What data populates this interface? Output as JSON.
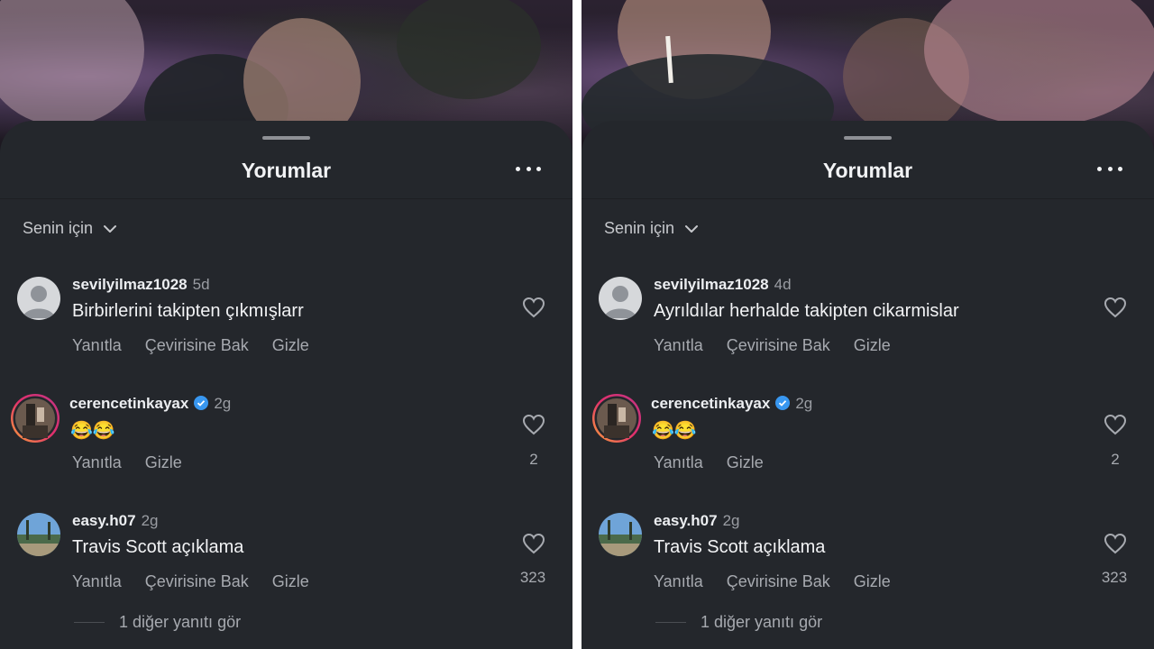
{
  "left": {
    "title": "Yorumlar",
    "filter_label": "Senin için",
    "comments": [
      {
        "username": "sevilyilmaz1028",
        "time": "5d",
        "text": "Birbirlerini takipten çıkmışlarr",
        "actions": [
          "Yanıtla",
          "Çevirisine Bak",
          "Gizle"
        ],
        "likes": ""
      },
      {
        "username": "cerencetinkayax",
        "time": "2g",
        "text": "😂😂",
        "actions": [
          "Yanıtla",
          "Gizle"
        ],
        "likes": "2"
      },
      {
        "username": "easy.h07",
        "time": "2g",
        "text": "Travis Scott açıklama",
        "actions": [
          "Yanıtla",
          "Çevirisine Bak",
          "Gizle"
        ],
        "likes": "323"
      }
    ],
    "more_replies": "1 diğer yanıtı gör"
  },
  "right": {
    "title": "Yorumlar",
    "filter_label": "Senin için",
    "comments": [
      {
        "username": "sevilyilmaz1028",
        "time": "4d",
        "text": "Ayrıldılar herhalde takipten cikarmislar",
        "actions": [
          "Yanıtla",
          "Çevirisine Bak",
          "Gizle"
        ],
        "likes": ""
      },
      {
        "username": "cerencetinkayax",
        "time": "2g",
        "text": "😂😂",
        "actions": [
          "Yanıtla",
          "Gizle"
        ],
        "likes": "2"
      },
      {
        "username": "easy.h07",
        "time": "2g",
        "text": "Travis Scott açıklama",
        "actions": [
          "Yanıtla",
          "Çevirisine Bak",
          "Gizle"
        ],
        "likes": "323"
      }
    ],
    "more_replies": "1 diğer yanıtı gör"
  },
  "colors": {
    "sheet": "#24272c",
    "verified": "#3897f0",
    "ring": "#d6249f"
  }
}
